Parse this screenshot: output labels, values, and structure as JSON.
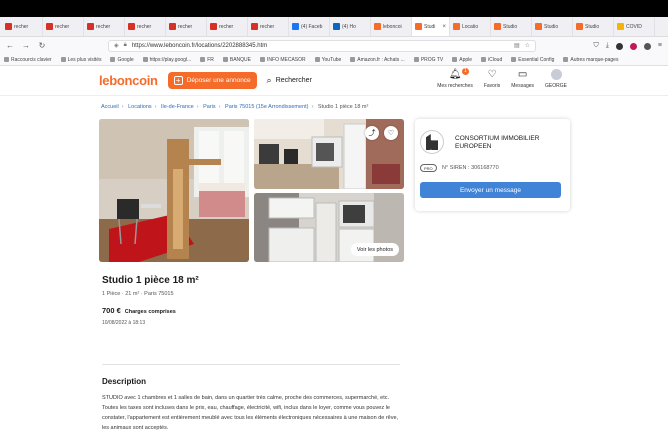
{
  "browser": {
    "tabs": [
      {
        "label": "recher",
        "color": "#d93025"
      },
      {
        "label": "recher",
        "color": "#d93025"
      },
      {
        "label": "recher",
        "color": "#d93025"
      },
      {
        "label": "recher",
        "color": "#d93025"
      },
      {
        "label": "recher",
        "color": "#d93025"
      },
      {
        "label": "recher",
        "color": "#d93025"
      },
      {
        "label": "recher",
        "color": "#d93025"
      },
      {
        "label": "(4) Faceb",
        "color": "#1877f2"
      },
      {
        "label": "(4) Ho",
        "color": "#0a66c2"
      },
      {
        "label": "leboncoi",
        "color": "#f56b2a"
      },
      {
        "label": "Studi",
        "color": "#f56b2a",
        "active": true
      },
      {
        "label": "Locatio",
        "color": "#f56b2a"
      },
      {
        "label": "Studio",
        "color": "#f56b2a"
      },
      {
        "label": "Studio",
        "color": "#f56b2a"
      },
      {
        "label": "Studio",
        "color": "#f56b2a"
      },
      {
        "label": "COVID",
        "color": "#f4b400"
      }
    ],
    "url": "https://www.leboncoin.fr/locations/2202888345.htm",
    "bookmarks": [
      "Raccourcis clavier",
      "Les plus visités",
      "Google",
      "https://play.googl...",
      "FR",
      "BANQUE",
      "INFO MECASOR",
      "YouTube",
      "Amazon.fr : Achats ...",
      "PROG TV",
      "Apple",
      "iCloud",
      "Essential Config",
      "Autres marque-pages"
    ]
  },
  "header": {
    "logo": "leboncoin",
    "deposit_label": "Déposer une annonce",
    "search_label": "Rechercher",
    "nav": [
      {
        "label": "Mes recherches",
        "icon": "bell-icon",
        "badge": "1"
      },
      {
        "label": "Favoris",
        "icon": "heart-icon"
      },
      {
        "label": "Messages",
        "icon": "message-icon"
      },
      {
        "label": "GEORGE",
        "icon": "avatar"
      }
    ]
  },
  "breadcrumb": [
    "Accueil",
    "Locations",
    "Ile-de-France",
    "Paris",
    "Paris 75015 (15e Arrondissement)",
    "Studio 1 pièce 18 m²"
  ],
  "photos": {
    "see_photos_label": "Voir les photos"
  },
  "seller": {
    "name": "CONSORTIUM IMMOBILIER EUROPEEN",
    "badge": "PRO",
    "siren": "N° SIREN : 306168770",
    "message_button": "Envoyer un message"
  },
  "listing": {
    "title": "Studio 1 pièce 18 m²",
    "subtitle": "1 Pièce · 21 m² · Paris 75015",
    "price": "700 €",
    "charges": "Charges comprises",
    "date": "10/08/2022 à 18:13",
    "description_title": "Description",
    "description": "STUDIO avec 1 chambres et 1 salles de bain, dans un quartier très calme, proche des commerces, supermarché, etc. Toutes les taxes sont incluses dans le prix, eau, chauffage, électricité, wifi, inclus dans le loyer, comme vous pouvez le constater, l'appartement est entièrement meublé avec tous les éléments électroniques nécessaires à une maison de rêve, les animaux sont acceptés."
  },
  "colors": {
    "brand": "#f56b2a",
    "link": "#2f6cb7",
    "primary_button": "#4183d7"
  }
}
